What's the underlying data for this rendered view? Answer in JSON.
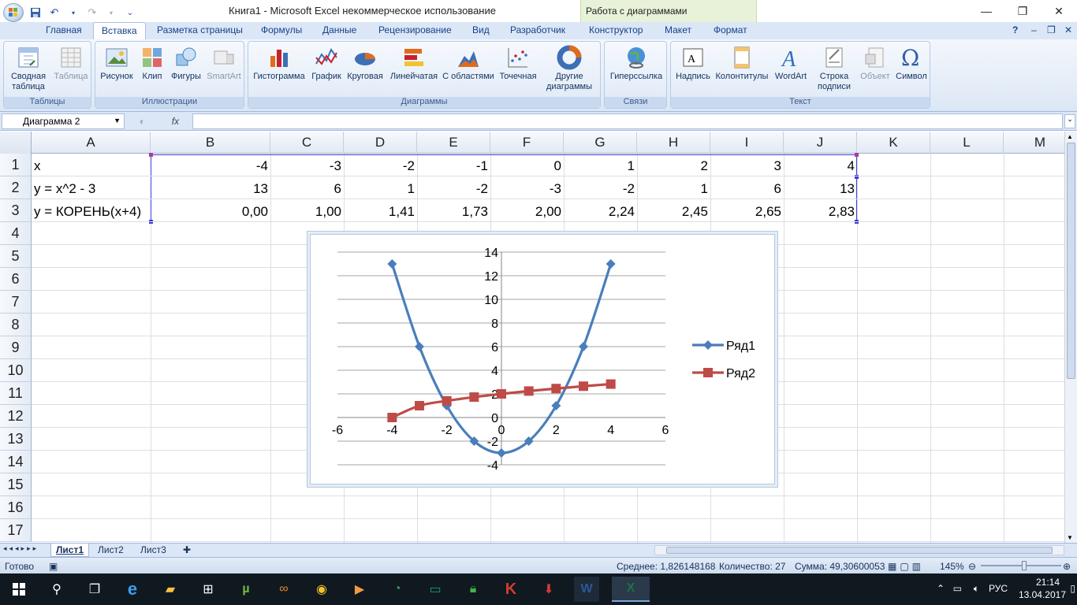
{
  "title_bar": {
    "window_title": "Книга1 - Microsoft Excel некоммерческое использование",
    "context_banner": "Работа с диаграммами",
    "controls": [
      "—",
      "❐",
      "✕"
    ]
  },
  "ribbon_tabs": [
    "Главная",
    "Вставка",
    "Разметка страницы",
    "Формулы",
    "Данные",
    "Рецензирование",
    "Вид",
    "Разработчик",
    "Конструктор",
    "Макет",
    "Формат"
  ],
  "ribbon": {
    "groups": {
      "tables": "Таблицы",
      "illustrations": "Иллюстрации",
      "charts": "Диаграммы",
      "links": "Связи",
      "text": "Текст"
    },
    "buttons": {
      "pivot": "Сводная таблица",
      "table": "Таблица",
      "picture": "Рисунок",
      "clip": "Клип",
      "shapes": "Фигуры",
      "smartart": "SmartArt",
      "histogram": "Гистограмма",
      "line": "График",
      "pie": "Круговая",
      "bar": "Линейчатая",
      "area": "С областями",
      "scatter": "Точечная",
      "other": "Другие диаграммы",
      "hyperlink": "Гиперссылка",
      "textbox": "Надпись",
      "header_footer": "Колонтитулы",
      "wordart": "WordArt",
      "signature": "Строка подписи",
      "object": "Объект",
      "symbol": "Символ"
    }
  },
  "formula_bar": {
    "name_box": "Диаграмма 2",
    "fx": "fx",
    "value": ""
  },
  "columns": [
    "A",
    "B",
    "C",
    "D",
    "E",
    "F",
    "G",
    "H",
    "I",
    "J",
    "K",
    "L",
    "M"
  ],
  "rows": [
    "1",
    "2",
    "3",
    "4",
    "5",
    "6",
    "7",
    "8",
    "9",
    "10",
    "11",
    "12",
    "13",
    "14",
    "15",
    "16",
    "17"
  ],
  "cells": {
    "row1": {
      "label": "x",
      "values": [
        "-4",
        "-3",
        "-2",
        "-1",
        "0",
        "1",
        "2",
        "3",
        "4"
      ]
    },
    "row2": {
      "label": "y = x^2 - 3",
      "values": [
        "13",
        "6",
        "1",
        "-2",
        "-3",
        "-2",
        "1",
        "6",
        "13"
      ]
    },
    "row3": {
      "label": "y = КОРЕНЬ(x+4)",
      "values": [
        "0,00",
        "1,00",
        "1,41",
        "1,73",
        "2,00",
        "2,24",
        "2,45",
        "2,65",
        "2,83"
      ]
    }
  },
  "chart_data": {
    "type": "scatter",
    "x": [
      -4,
      -3,
      -2,
      -1,
      0,
      1,
      2,
      3,
      4
    ],
    "series": [
      {
        "name": "Ряд1",
        "values": [
          13,
          6,
          1,
          -2,
          -3,
          -2,
          1,
          6,
          13
        ],
        "color": "#4a7ebb",
        "marker": "diamond"
      },
      {
        "name": "Ряд2",
        "values": [
          0,
          1,
          1.41,
          1.73,
          2,
          2.24,
          2.45,
          2.65,
          2.83
        ],
        "color": "#be4b48",
        "marker": "square"
      }
    ],
    "xlim": [
      -6,
      6
    ],
    "ylim": [
      -4,
      14
    ],
    "x_ticks": [
      "-6",
      "-4",
      "-2",
      "0",
      "2",
      "4",
      "6"
    ],
    "y_ticks": [
      "-4",
      "-2",
      "0",
      "2",
      "4",
      "6",
      "8",
      "10",
      "12",
      "14"
    ],
    "legend": "right",
    "grid": true,
    "smooth": true
  },
  "sheets": [
    "Лист1",
    "Лист2",
    "Лист3"
  ],
  "status": {
    "ready": "Готово",
    "average": "Среднее: 1,826148168",
    "count": "Количество: 27",
    "sum": "Сумма: 49,30600053",
    "zoom": "145%"
  },
  "taskbar": {
    "language": "РУС",
    "time": "21:14",
    "date": "13.04.2017"
  }
}
